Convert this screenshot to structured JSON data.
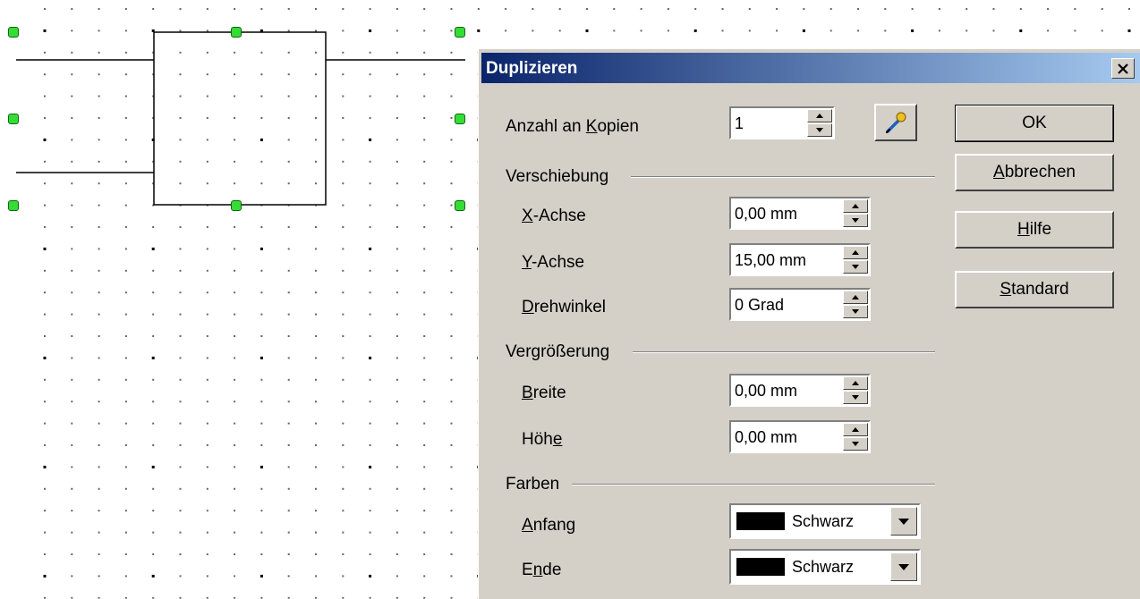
{
  "dialog": {
    "title": "Duplizieren",
    "close_glyph": "✕",
    "copies": {
      "label_pre": "Anzahl an ",
      "label_key": "K",
      "label_post": "opien",
      "value": "1"
    },
    "groups": {
      "offset": "Verschiebung",
      "enlargement": "Vergrößerung",
      "colors": "Farben"
    },
    "fields": {
      "x_axis": {
        "key": "X",
        "post": "-Achse",
        "value": "0,00 mm"
      },
      "y_axis": {
        "key": "Y",
        "post": "-Achse",
        "value": "15,00 mm"
      },
      "rotation": {
        "key": "D",
        "post": "rehwinkel",
        "value": "0 Grad"
      },
      "width": {
        "key": "B",
        "post": "reite",
        "value": "0,00 mm"
      },
      "height": {
        "pre": "Höh",
        "key": "e",
        "value": "0,00 mm"
      }
    },
    "color_fields": {
      "start": {
        "key": "A",
        "post": "nfang",
        "value": "Schwarz",
        "swatch": "#000000"
      },
      "end": {
        "pre": "E",
        "key": "n",
        "post": "de",
        "value": "Schwarz",
        "swatch": "#000000"
      }
    },
    "buttons": {
      "ok": "OK",
      "cancel_key": "A",
      "cancel_post": "bbrechen",
      "help_key": "H",
      "help_post": "ilfe",
      "reset_key": "S",
      "reset_post": "tandard"
    }
  },
  "colors": {
    "title_start": "#0a246a",
    "title_end": "#a6caf0",
    "dialog_bg": "#d4d0c8",
    "handle": "#33dd33"
  }
}
